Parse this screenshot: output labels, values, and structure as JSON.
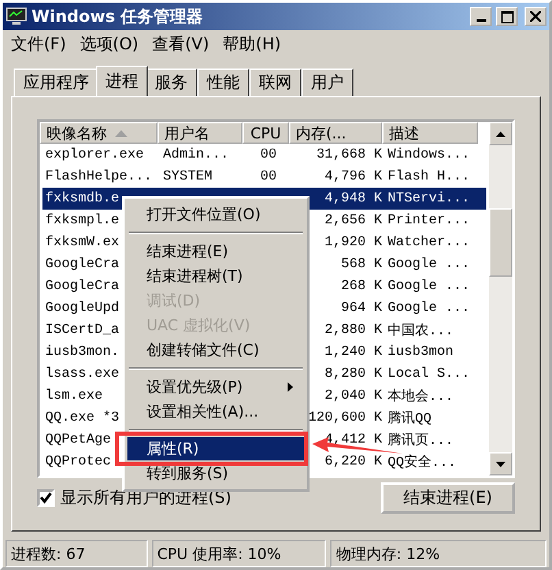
{
  "window": {
    "title": "Windows 任务管理器"
  },
  "menu_bar": [
    "文件(F)",
    "选项(O)",
    "查看(V)",
    "帮助(H)"
  ],
  "tabs": [
    {
      "label": "应用程序",
      "selected": false
    },
    {
      "label": "进程",
      "selected": true
    },
    {
      "label": "服务",
      "selected": false
    },
    {
      "label": "性能",
      "selected": false
    },
    {
      "label": "联网",
      "selected": false
    },
    {
      "label": "用户",
      "selected": false
    }
  ],
  "table": {
    "columns": [
      "映像名称",
      "用户名",
      "CPU",
      "内存(...",
      "描述"
    ],
    "rows": [
      {
        "cells": [
          "explorer.exe",
          "Admin...",
          "00",
          "31,668 K",
          "Windows..."
        ],
        "selected": false
      },
      {
        "cells": [
          "FlashHelpe...",
          "SYSTEM",
          "00",
          "4,796 K",
          "Flash H..."
        ],
        "selected": false
      },
      {
        "cells": [
          "fxksmdb.e",
          "",
          "",
          "4,948 K",
          "NTServi..."
        ],
        "selected": true
      },
      {
        "cells": [
          "fxksmpl.e",
          "",
          "",
          "2,656 K",
          "Printer..."
        ],
        "selected": false
      },
      {
        "cells": [
          "fxksmW.ex",
          "",
          "",
          "1,920 K",
          "Watcher..."
        ],
        "selected": false
      },
      {
        "cells": [
          "GoogleCra",
          "",
          "",
          "568 K",
          "Google ..."
        ],
        "selected": false
      },
      {
        "cells": [
          "GoogleCra",
          "",
          "",
          "268 K",
          "Google ..."
        ],
        "selected": false
      },
      {
        "cells": [
          "GoogleUpd",
          "",
          "",
          "964 K",
          "Google ..."
        ],
        "selected": false
      },
      {
        "cells": [
          "ISCertD_a",
          "",
          "",
          "2,880 K",
          "中国农..."
        ],
        "selected": false
      },
      {
        "cells": [
          "iusb3mon.",
          "",
          "",
          "1,240 K",
          "iusb3mon"
        ],
        "selected": false
      },
      {
        "cells": [
          "lsass.exe",
          "",
          "",
          "8,280 K",
          "Local S..."
        ],
        "selected": false
      },
      {
        "cells": [
          "lsm.exe",
          "",
          "",
          "2,040 K",
          "本地会..."
        ],
        "selected": false
      },
      {
        "cells": [
          "QQ.exe *3",
          "",
          "",
          "120,600 K",
          "腾讯QQ"
        ],
        "selected": false
      },
      {
        "cells": [
          "QQPetAge",
          "",
          "",
          "4,412 K",
          "腾讯页..."
        ],
        "selected": false
      },
      {
        "cells": [
          "QQProtec",
          "",
          "",
          "6,220 K",
          "QQ安全..."
        ],
        "selected": false
      }
    ]
  },
  "context_menu": [
    {
      "kind": "item",
      "label": "打开文件位置(O)",
      "disabled": false,
      "selected": false,
      "submenu": false
    },
    {
      "kind": "separator"
    },
    {
      "kind": "item",
      "label": "结束进程(E)",
      "disabled": false,
      "selected": false,
      "submenu": false
    },
    {
      "kind": "item",
      "label": "结束进程树(T)",
      "disabled": false,
      "selected": false,
      "submenu": false
    },
    {
      "kind": "item",
      "label": "调试(D)",
      "disabled": true,
      "selected": false,
      "submenu": false
    },
    {
      "kind": "item",
      "label": "UAC 虚拟化(V)",
      "disabled": true,
      "selected": false,
      "submenu": false
    },
    {
      "kind": "item",
      "label": "创建转储文件(C)",
      "disabled": false,
      "selected": false,
      "submenu": false
    },
    {
      "kind": "separator"
    },
    {
      "kind": "item",
      "label": "设置优先级(P)",
      "disabled": false,
      "selected": false,
      "submenu": true
    },
    {
      "kind": "item",
      "label": "设置相关性(A)...",
      "disabled": false,
      "selected": false,
      "submenu": false
    },
    {
      "kind": "separator"
    },
    {
      "kind": "item",
      "label": "属性(R)",
      "disabled": false,
      "selected": true,
      "submenu": false
    },
    {
      "kind": "item",
      "label": "转到服务(S)",
      "disabled": false,
      "selected": false,
      "submenu": false
    }
  ],
  "show_all_users": {
    "label": "显示所有用户的进程(S)",
    "checked": true
  },
  "end_button": "结束进程(E)",
  "status_bar": [
    "进程数: 67",
    "CPU 使用率: 10%",
    "物理内存: 12%"
  ]
}
